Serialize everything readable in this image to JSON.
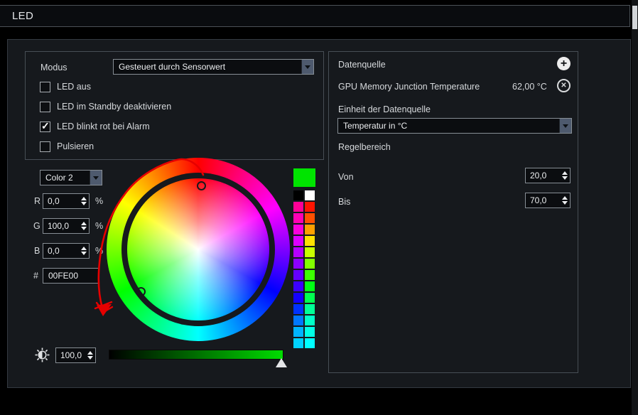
{
  "window": {
    "title": "LED"
  },
  "icons": {
    "add": "+",
    "remove": "✕"
  },
  "left_panel": {
    "modus": {
      "label": "Modus",
      "value": "Gesteuert durch Sensorwert"
    },
    "checkboxes": [
      {
        "label": "LED aus",
        "checked": false
      },
      {
        "label": "LED im Standby deaktivieren",
        "checked": false
      },
      {
        "label": "LED blinkt rot bei Alarm",
        "checked": true
      },
      {
        "label": "Pulsieren",
        "checked": false
      }
    ]
  },
  "color_editor": {
    "color_select": {
      "value": "Color 2"
    },
    "channels": [
      {
        "label": "R",
        "value": "0,0",
        "unit": "%"
      },
      {
        "label": "G",
        "value": "100,0",
        "unit": "%"
      },
      {
        "label": "B",
        "value": "0,0",
        "unit": "%"
      }
    ],
    "hex": {
      "label": "#",
      "value": "00FE00"
    },
    "preview_color": "#00e400",
    "gradient_end": "#00dd00",
    "brightness": {
      "value": "100,0"
    },
    "swatches": [
      [
        "#000000",
        "#ffffff"
      ],
      [
        "#ff0096",
        "#ff1400"
      ],
      [
        "#ff00b4",
        "#ff5000"
      ],
      [
        "#fa00dc",
        "#ffa000"
      ],
      [
        "#dc00ff",
        "#ffe100"
      ],
      [
        "#b400ff",
        "#c8ff00"
      ],
      [
        "#8c00ff",
        "#82ff00"
      ],
      [
        "#6400ff",
        "#3cff00"
      ],
      [
        "#3c00ff",
        "#00ff14"
      ],
      [
        "#1400ff",
        "#00ff50"
      ],
      [
        "#0032ff",
        "#00ff96"
      ],
      [
        "#0078ff",
        "#00ffc8"
      ],
      [
        "#00b4ff",
        "#00ffe6"
      ],
      [
        "#00d2ff",
        "#00ffff"
      ]
    ]
  },
  "right_panel": {
    "datenquelle_label": "Datenquelle",
    "sensor": {
      "name": "GPU Memory Junction Temperature",
      "value": "62,00 °C"
    },
    "einheit_label": "Einheit der Datenquelle",
    "einheit_value": "Temperatur in °C",
    "regelbereich_label": "Regelbereich",
    "von": {
      "label": "Von",
      "value": "20,0"
    },
    "bis": {
      "label": "Bis",
      "value": "70,0"
    }
  }
}
